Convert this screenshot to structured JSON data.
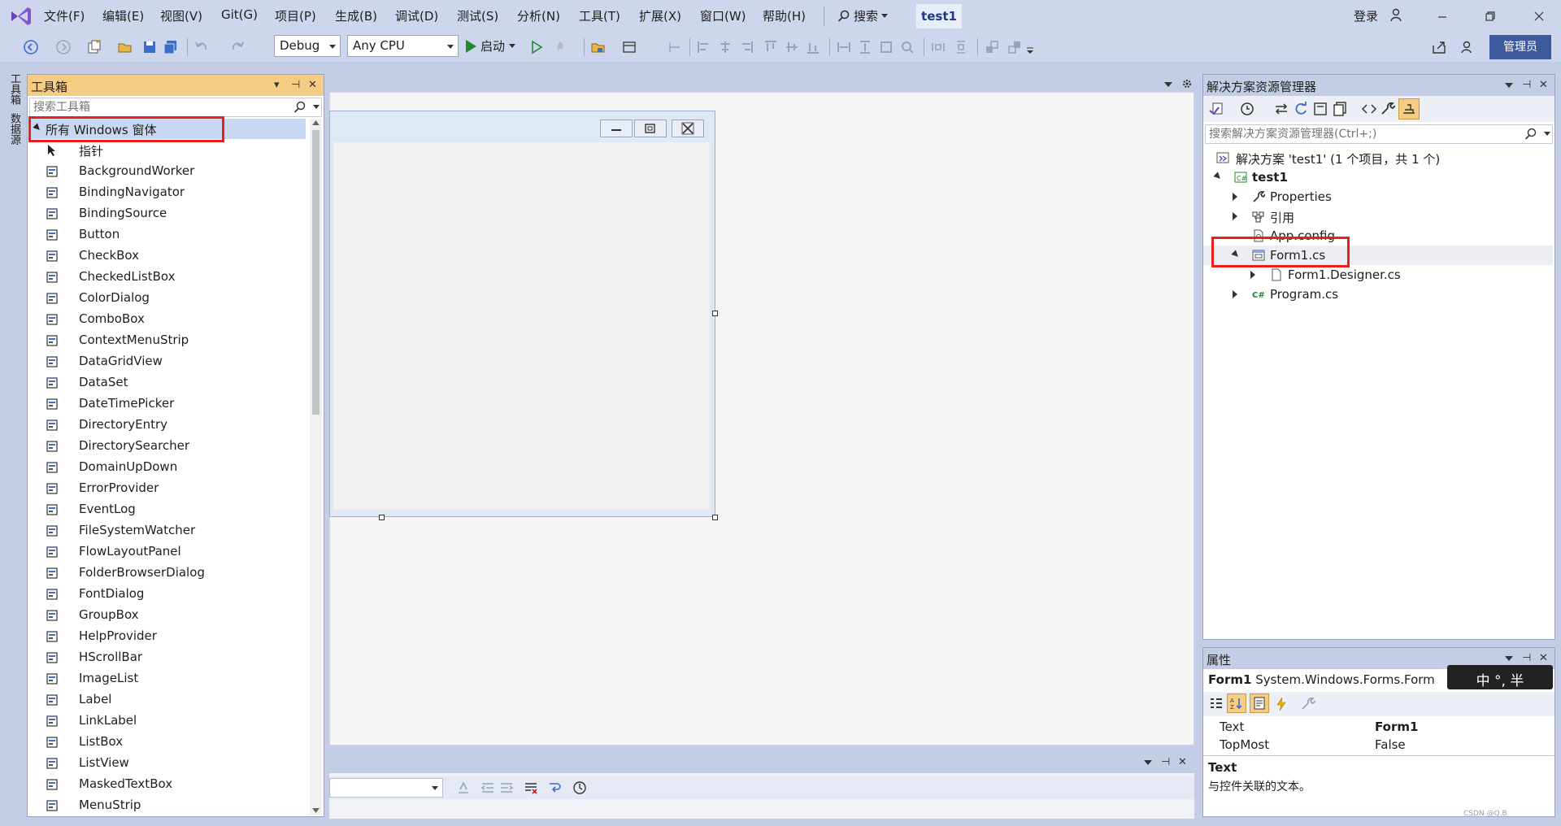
{
  "menubar": {
    "items": [
      "文件(F)",
      "编辑(E)",
      "视图(V)",
      "Git(G)",
      "项目(P)",
      "生成(B)",
      "调试(D)",
      "测试(S)",
      "分析(N)",
      "工具(T)",
      "扩展(X)",
      "窗口(W)",
      "帮助(H)"
    ],
    "search_label": "搜索",
    "solution_name": "test1",
    "login_label": "登录"
  },
  "toolbar": {
    "config": "Debug",
    "platform": "Any CPU",
    "start_label": "启动",
    "admin_label": "管理员"
  },
  "left_tabs": [
    "工具箱",
    "数据源"
  ],
  "toolbox": {
    "title": "工具箱",
    "search_placeholder": "搜索工具箱",
    "group_label": "所有 Windows 窗体",
    "items": [
      "指针",
      "BackgroundWorker",
      "BindingNavigator",
      "BindingSource",
      "Button",
      "CheckBox",
      "CheckedListBox",
      "ColorDialog",
      "ComboBox",
      "ContextMenuStrip",
      "DataGridView",
      "DataSet",
      "DateTimePicker",
      "DirectoryEntry",
      "DirectorySearcher",
      "DomainUpDown",
      "ErrorProvider",
      "EventLog",
      "FileSystemWatcher",
      "FlowLayoutPanel",
      "FolderBrowserDialog",
      "FontDialog",
      "GroupBox",
      "HelpProvider",
      "HScrollBar",
      "ImageList",
      "Label",
      "LinkLabel",
      "ListBox",
      "ListView",
      "MaskedTextBox",
      "MenuStrip"
    ]
  },
  "solution_explorer": {
    "title": "解决方案资源管理器",
    "search_placeholder": "搜索解决方案资源管理器(Ctrl+;)",
    "solution_label": "解决方案 'test1' (1 个项目，共 1 个)",
    "project_label": "test1",
    "nodes": [
      "Properties",
      "引用",
      "App.config",
      "Form1.cs",
      "Form1.Designer.cs",
      "Program.cs"
    ]
  },
  "properties": {
    "title": "属性",
    "object_name": "Form1",
    "object_type": "System.Windows.Forms.Form",
    "rows": [
      {
        "name": "Text",
        "value": "Form1"
      },
      {
        "name": "TopMost",
        "value": "False"
      }
    ],
    "desc_title": "Text",
    "desc_text": "与控件关联的文本。"
  },
  "ime": {
    "text": "中 °, 半"
  },
  "watermark": "CSDN @Q.B"
}
